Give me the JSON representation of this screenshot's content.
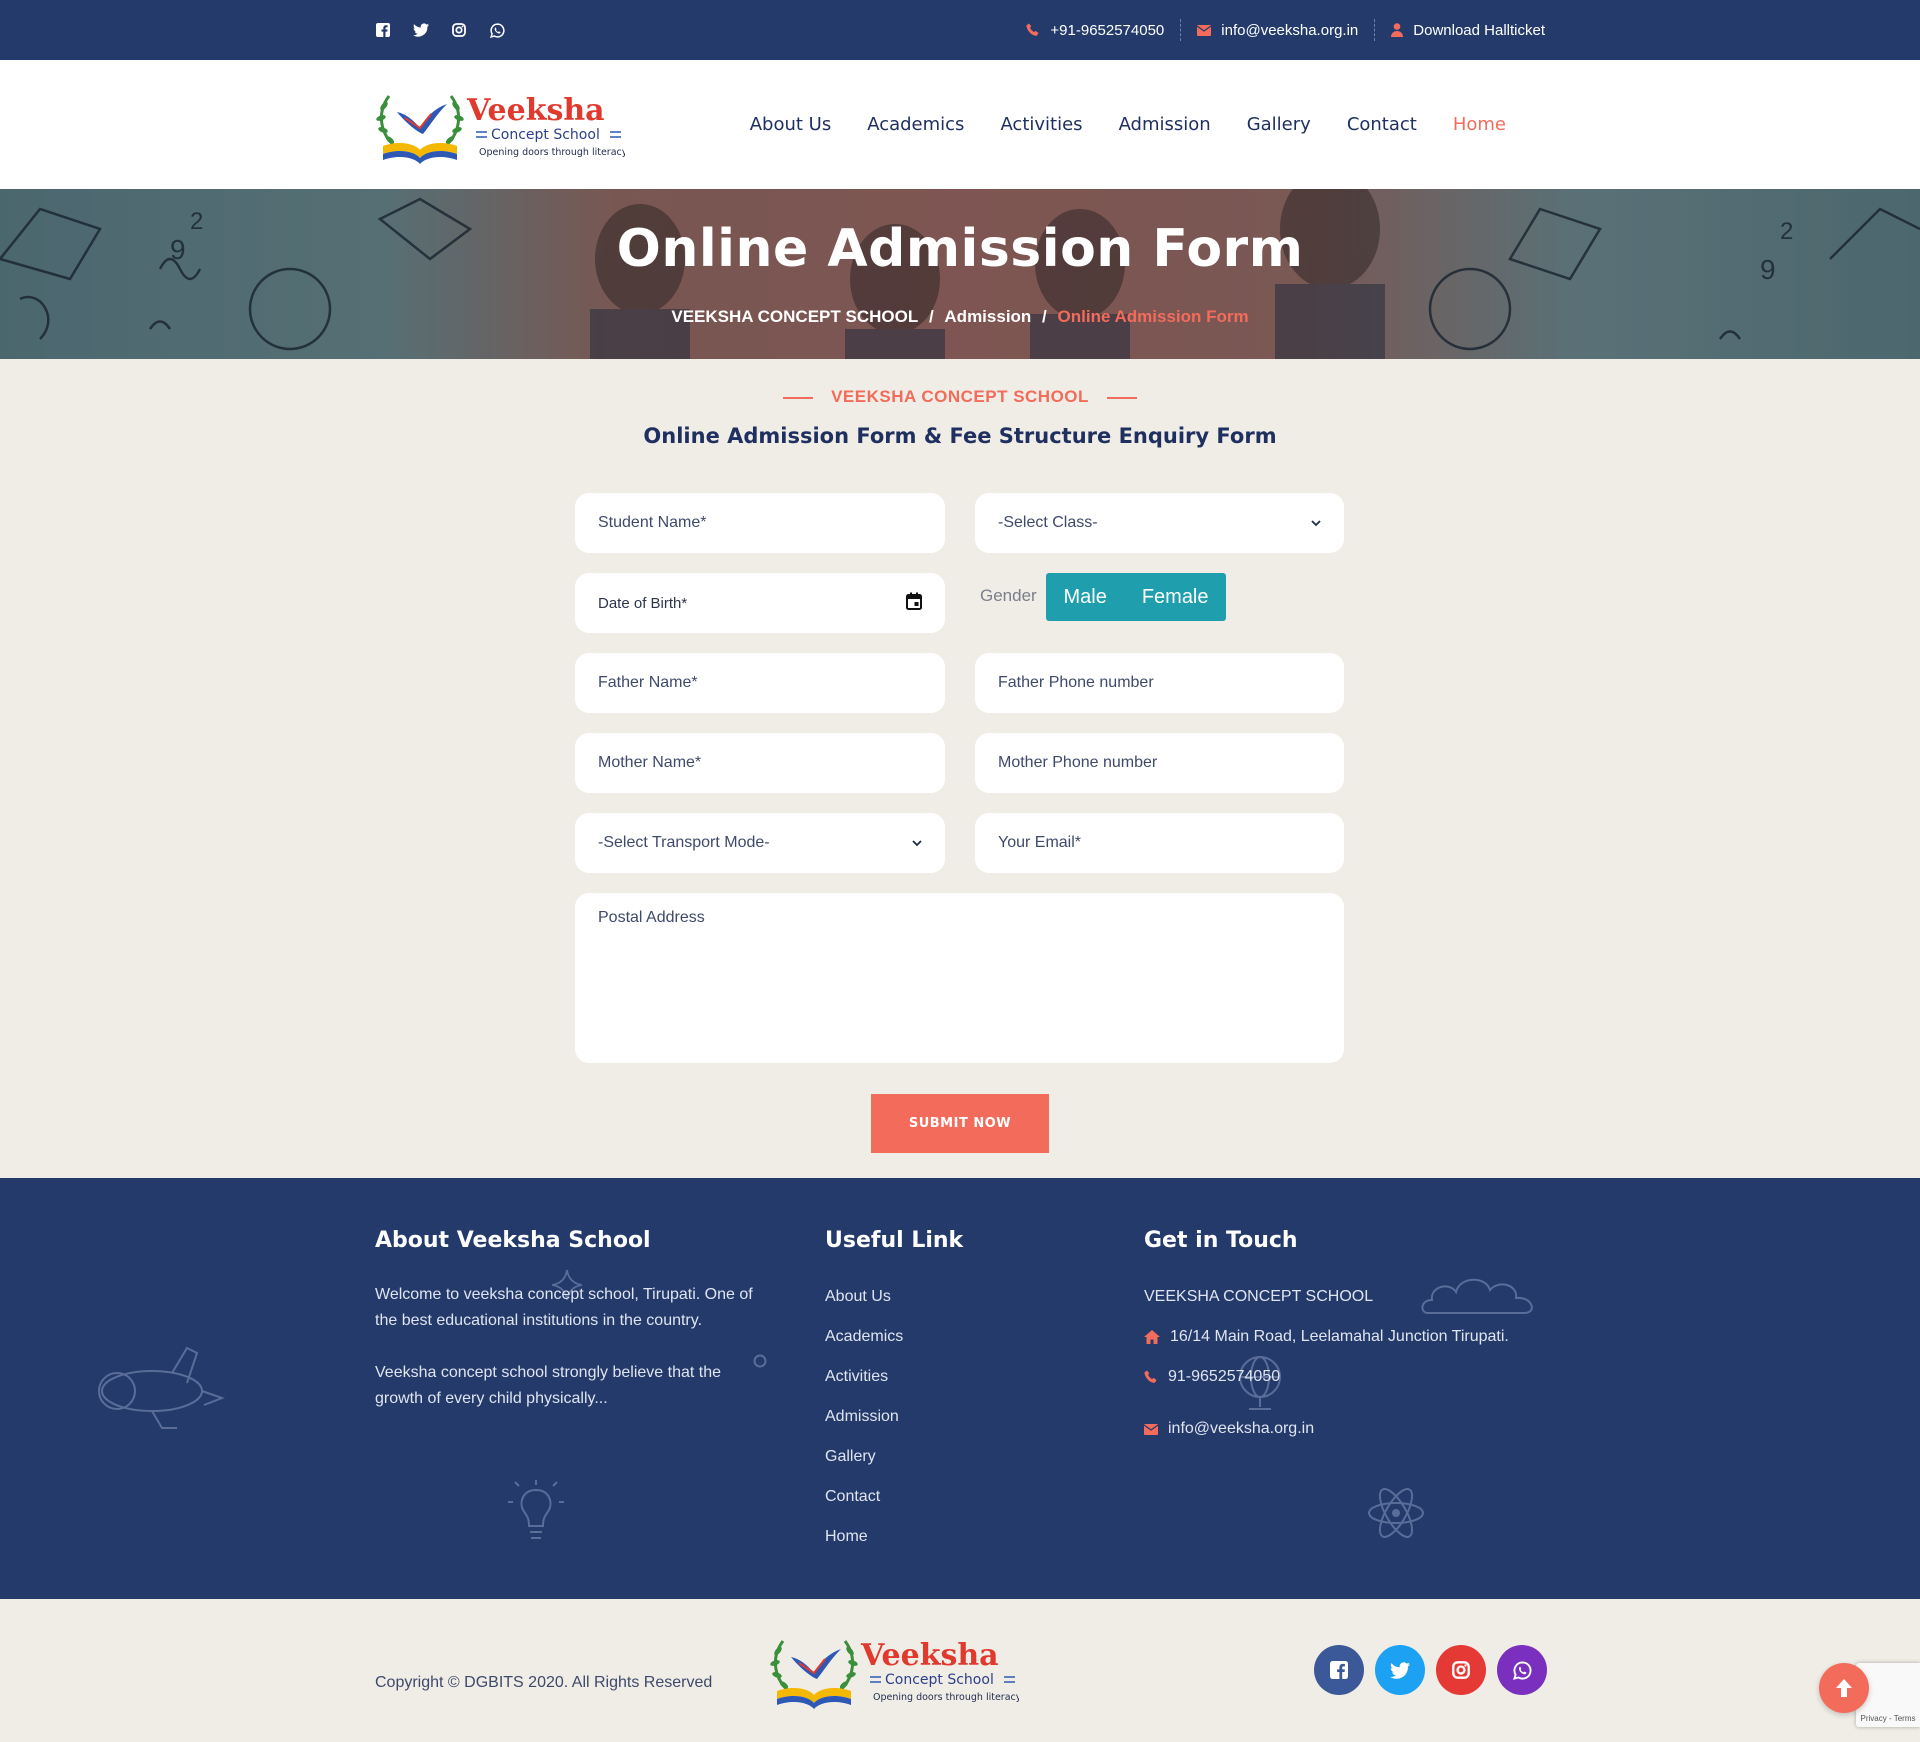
{
  "topbar": {
    "social_icons": [
      "facebook-icon",
      "twitter-icon",
      "instagram-icon",
      "whatsapp-icon"
    ],
    "phone": "+91-9652574050",
    "email": "info@veeksha.org.in",
    "download": "Download Hallticket"
  },
  "logo": {
    "name": "Veeksha",
    "sub": "Concept School",
    "tagline": "Opening doors through literacy"
  },
  "nav": {
    "items": [
      "About Us",
      "Academics",
      "Activities",
      "Admission",
      "Gallery",
      "Contact",
      "Home"
    ],
    "active": "Home"
  },
  "banner": {
    "title": "Online Admission Form",
    "crumbs": [
      "VEEKSHA CONCEPT SCHOOL",
      "Admission",
      "Online Admission Form"
    ]
  },
  "section": {
    "tag": "VEEKSHA CONCEPT SCHOOL",
    "title": "Online Admission Form & Fee Structure Enquiry Form"
  },
  "form": {
    "student_name": "Student Name*",
    "select_class": "-Select Class-",
    "dob": "Date of Birth*",
    "gender_label": "Gender",
    "gender_options": [
      "Male",
      "Female"
    ],
    "father_name": "Father Name*",
    "father_phone": "Father Phone number",
    "mother_name": "Mother Name*",
    "mother_phone": "Mother Phone number",
    "transport": "-Select Transport Mode-",
    "email": "Your Email*",
    "address": "Postal Address",
    "submit": "SUBMIT NOW"
  },
  "footer": {
    "about_title": "About Veeksha School",
    "about_p1": "Welcome to veeksha concept school, Tirupati. One of the best educational institutions in the country.",
    "about_p2": "Veeksha concept school strongly believe that the growth of every child physically...",
    "links_title": "Useful Link",
    "links": [
      "About Us",
      "Academics",
      "Activities",
      "Admission",
      "Gallery",
      "Contact",
      "Home"
    ],
    "touch_title": "Get in Touch",
    "school": "VEEKSHA CONCEPT SCHOOL",
    "address": "16/14 Main Road, Leelamahal Junction Tirupati.",
    "phone": "91-9652574050",
    "email": "info@veeksha.org.in"
  },
  "bottom": {
    "copyright": "Copyright © DGBITS 2020. All Rights Reserved",
    "social": [
      {
        "icon": "facebook-icon",
        "color": "#3b5998"
      },
      {
        "icon": "twitter-icon",
        "color": "#1da1f2"
      },
      {
        "icon": "instagram-icon",
        "color": "#e53935"
      },
      {
        "icon": "whatsapp-icon",
        "color": "#7b2fbe"
      }
    ],
    "recaptcha": "Privacy - Terms"
  },
  "colors": {
    "navy": "#243a6b",
    "accent": "#f36b5b",
    "teal": "#1f9fae",
    "bg": "#f0ede6"
  }
}
